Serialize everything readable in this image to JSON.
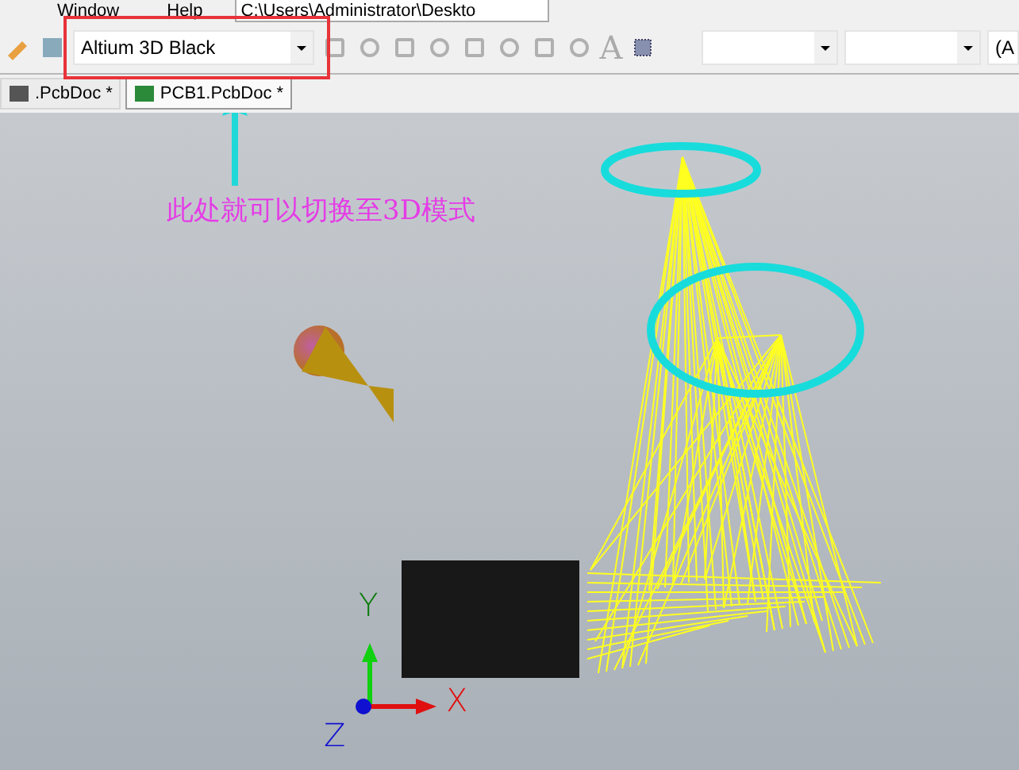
{
  "menu": [
    {
      "label": "Window"
    },
    {
      "label": "Help"
    }
  ],
  "path_field": {
    "value": "C:\\Users\\Administrator\\Deskto"
  },
  "view_combo": {
    "value": "Altium 3D Black"
  },
  "text_tool": {
    "glyph": "A"
  },
  "toolbar_tail": {
    "text": "(A"
  },
  "tabs": [
    {
      "label": ".PcbDoc *",
      "selected": false
    },
    {
      "label": "PCB1.PcbDoc *",
      "selected": true
    }
  ],
  "annotation": {
    "text": "此处就可以切换至3D模式"
  },
  "axes": [
    {
      "label": "X"
    },
    {
      "label": "Y"
    },
    {
      "label": "Z"
    }
  ]
}
